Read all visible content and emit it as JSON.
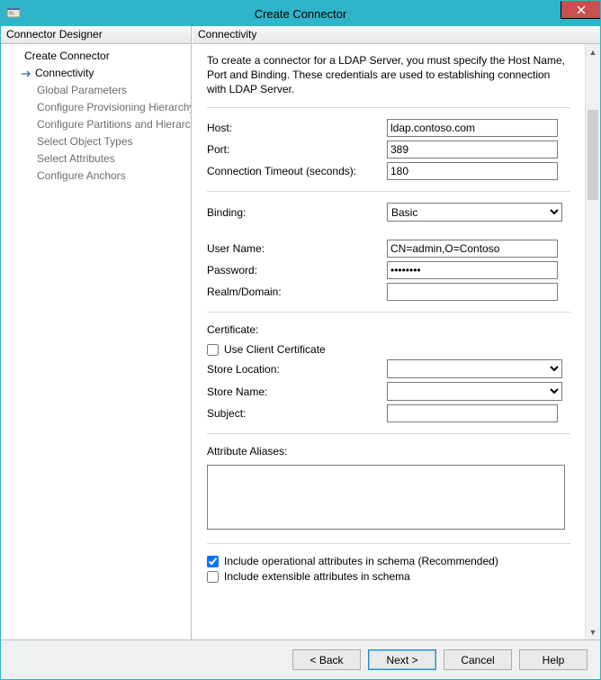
{
  "window": {
    "title": "Create Connector"
  },
  "sidebar": {
    "header": "Connector Designer",
    "items": [
      {
        "label": "Create Connector",
        "sub": false,
        "selected": false
      },
      {
        "label": "Connectivity",
        "sub": false,
        "selected": true
      },
      {
        "label": "Global Parameters",
        "sub": true,
        "selected": false
      },
      {
        "label": "Configure Provisioning Hierarchy",
        "sub": true,
        "selected": false
      },
      {
        "label": "Configure Partitions and Hierarchies",
        "sub": true,
        "selected": false
      },
      {
        "label": "Select Object Types",
        "sub": true,
        "selected": false
      },
      {
        "label": "Select Attributes",
        "sub": true,
        "selected": false
      },
      {
        "label": "Configure Anchors",
        "sub": true,
        "selected": false
      }
    ]
  },
  "main": {
    "header": "Connectivity",
    "intro": "To create a connector for a LDAP Server, you must specify the Host Name, Port and Binding. These credentials are used to establishing connection with LDAP Server.",
    "labels": {
      "host": "Host:",
      "port": "Port:",
      "timeout": "Connection Timeout (seconds):",
      "binding": "Binding:",
      "username": "User Name:",
      "password": "Password:",
      "realm": "Realm/Domain:",
      "certificate": "Certificate:",
      "use_client_cert": "Use Client Certificate",
      "store_location": "Store Location:",
      "store_name": "Store Name:",
      "subject": "Subject:",
      "attribute_aliases": "Attribute Aliases:",
      "include_operational": "Include operational attributes in schema (Recommended)",
      "include_extensible": "Include extensible attributes in schema"
    },
    "values": {
      "host": "ldap.contoso.com",
      "port": "389",
      "timeout": "180",
      "binding": "Basic",
      "username": "CN=admin,O=Contoso",
      "password": "••••••••",
      "realm": "",
      "use_client_cert": false,
      "store_location": "",
      "store_name": "",
      "subject": "",
      "attribute_aliases": "",
      "include_operational": true,
      "include_extensible": false
    }
  },
  "footer": {
    "back": "<  Back",
    "next": "Next  >",
    "cancel": "Cancel",
    "help": "Help"
  }
}
